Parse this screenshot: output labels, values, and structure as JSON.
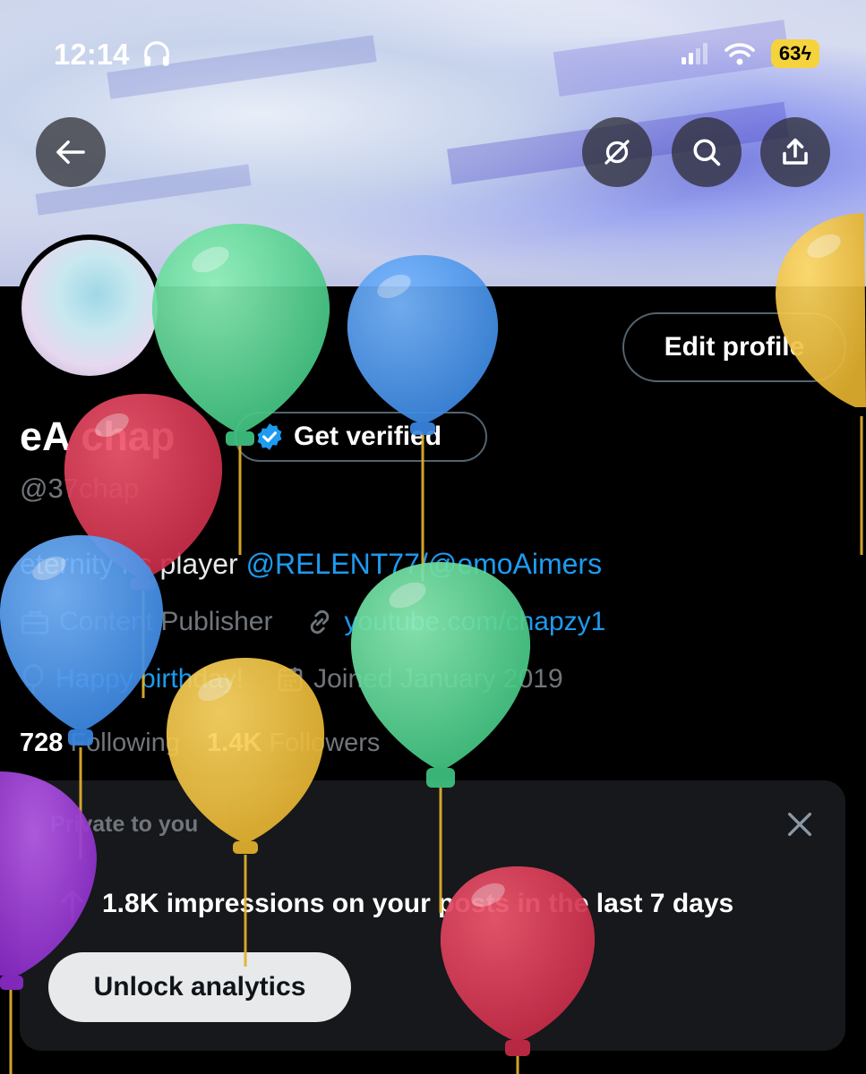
{
  "status_bar": {
    "time": "12:14",
    "battery": "63"
  },
  "header": {
    "back_icon": "arrow-left-icon",
    "icons": [
      "broken-link-icon",
      "search-icon",
      "share-icon"
    ]
  },
  "profile": {
    "edit_label": "Edit profile",
    "name": "eA chap",
    "verify_label": "Get verified",
    "handle": "@37chap",
    "bio_text": "eternity hs player",
    "bio_link_1": "@RELENT77",
    "bio_sep": "/",
    "bio_link_2": "@emoAimers",
    "category": "Content Publisher",
    "website": "youtube.com/chapzy1",
    "birthday": "Happy birthday!",
    "joined": "Joined January 2019",
    "following_count": "728",
    "following_label": "Following",
    "followers_count": "1.4K",
    "followers_label": "Followers"
  },
  "analytics_card": {
    "label": "Private to you",
    "text": "1.8K impressions on your posts in the last 7 days",
    "button": "Unlock analytics"
  },
  "colors": {
    "accent": "#1d9bf0",
    "battery": "#f5d33c",
    "background": "#000000"
  }
}
